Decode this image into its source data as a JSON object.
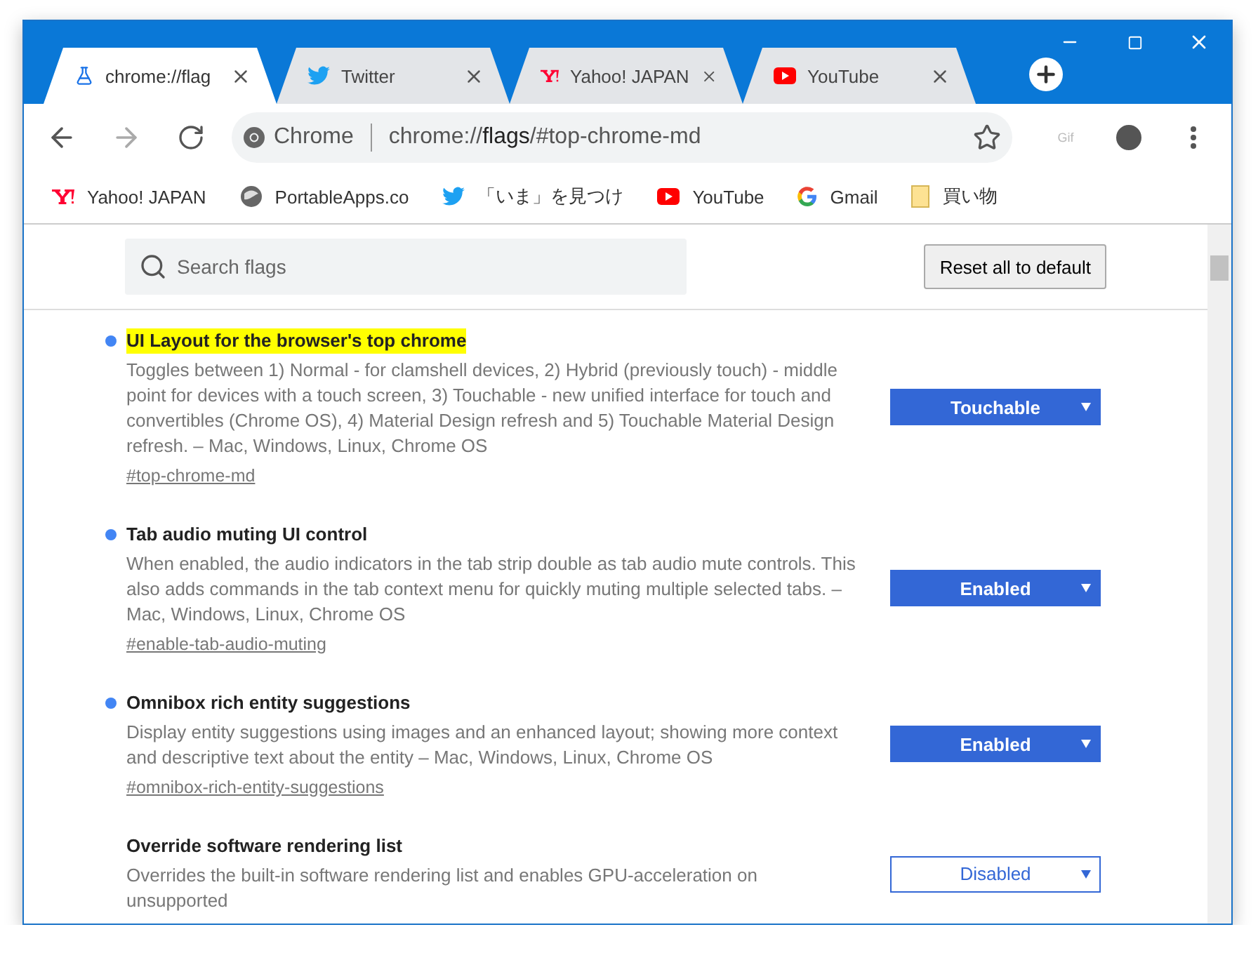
{
  "tabs": [
    {
      "label": "chrome://flag",
      "selected": true
    },
    {
      "label": "Twitter",
      "selected": false
    },
    {
      "label": "Yahoo! JAPAN",
      "selected": false
    },
    {
      "label": "YouTube",
      "selected": false
    }
  ],
  "omnibox": {
    "site": "Chrome",
    "url_plain": "chrome://",
    "url_bold": "flags",
    "url_rest": "/#top-chrome-md"
  },
  "extension": {
    "label": "Gif"
  },
  "bookmarks": [
    {
      "label": "Yahoo! JAPAN"
    },
    {
      "label": "PortableApps.co"
    },
    {
      "label": "「いま」を見つけ"
    },
    {
      "label": "YouTube"
    },
    {
      "label": "Gmail"
    },
    {
      "label": "買い物"
    }
  ],
  "search": {
    "placeholder": "Search flags"
  },
  "reset_button": "Reset all to default",
  "flags": [
    {
      "title": "UI Layout for the browser's top chrome",
      "highlighted": true,
      "modified": true,
      "description": "Toggles between 1) Normal - for clamshell devices, 2) Hybrid (previously touch) - middle point for devices with a touch screen, 3) Touchable - new unified interface for touch and convertibles (Chrome OS), 4) Material Design refresh and 5) Touchable Material Design refresh. – Mac, Windows, Linux, Chrome OS",
      "link": "#top-chrome-md",
      "value": "Touchable"
    },
    {
      "title": "Tab audio muting UI control",
      "highlighted": false,
      "modified": true,
      "description": "When enabled, the audio indicators in the tab strip double as tab audio mute controls. This also adds commands in the tab context menu for quickly muting multiple selected tabs. – Mac, Windows, Linux, Chrome OS",
      "link": "#enable-tab-audio-muting",
      "value": "Enabled"
    },
    {
      "title": "Omnibox rich entity suggestions",
      "highlighted": false,
      "modified": true,
      "description": "Display entity suggestions using images and an enhanced layout; showing more context and descriptive text about the entity – Mac, Windows, Linux, Chrome OS",
      "link": "#omnibox-rich-entity-suggestions",
      "value": "Enabled"
    },
    {
      "title": "Override software rendering list",
      "highlighted": false,
      "modified": false,
      "description": "Overrides the built-in software rendering list and enables GPU-acceleration on unsupported",
      "value": "Disabled"
    }
  ]
}
